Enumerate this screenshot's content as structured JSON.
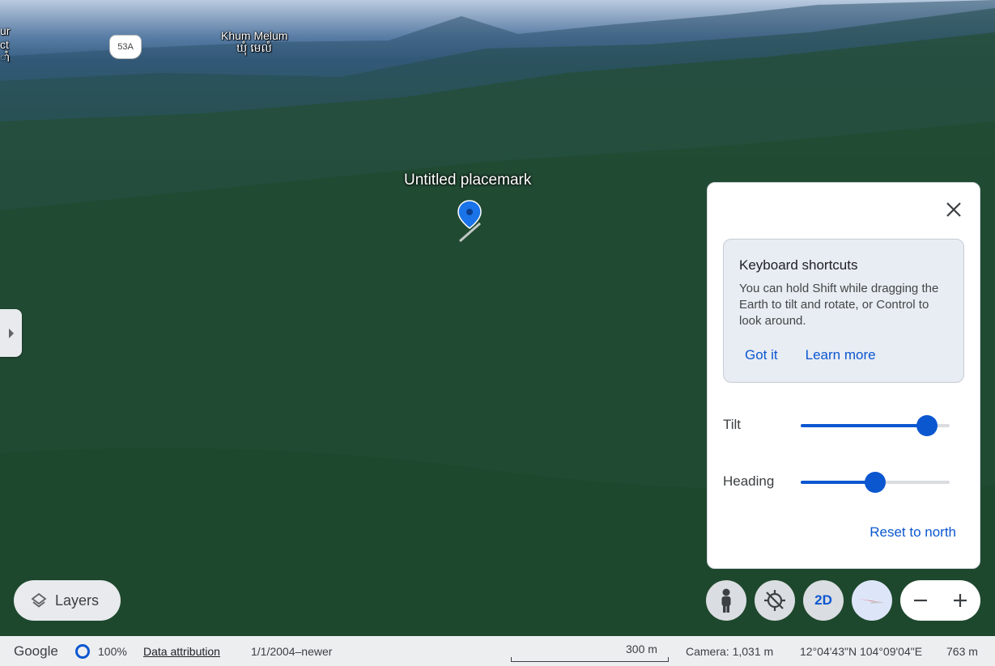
{
  "map": {
    "labels": {
      "partial_left": [
        "ur",
        "ct",
        "ាំ"
      ],
      "route_shield": "53A",
      "place_name_latin": "Khum Melum",
      "place_name_khmer": "ឃុំ មេលំ"
    },
    "placemark_label": "Untitled placemark"
  },
  "panel": {
    "tip": {
      "title": "Keyboard shortcuts",
      "body": "You can hold Shift while dragging the Earth to tilt and rotate, or Control to look around.",
      "got_it": "Got it",
      "learn_more": "Learn more"
    },
    "tilt": {
      "label": "Tilt",
      "value_fraction": 0.85
    },
    "heading": {
      "label": "Heading",
      "value_fraction": 0.5
    },
    "reset_label": "Reset to north"
  },
  "controls": {
    "layers_label": "Layers",
    "view_2d_label": "2D"
  },
  "statusbar": {
    "logo": "Google",
    "progress": "100%",
    "attribution": "Data attribution",
    "date_range": "1/1/2004–newer",
    "scale": "300 m",
    "camera": "Camera: 1,031 m",
    "coords": "12°04'43\"N 104°09'04\"E",
    "elevation": "763 m"
  },
  "colors": {
    "accent": "#0b57d0",
    "panel_bg": "#ffffff",
    "tip_bg": "#e8ecf3",
    "statusbar_bg": "#eceef0"
  }
}
